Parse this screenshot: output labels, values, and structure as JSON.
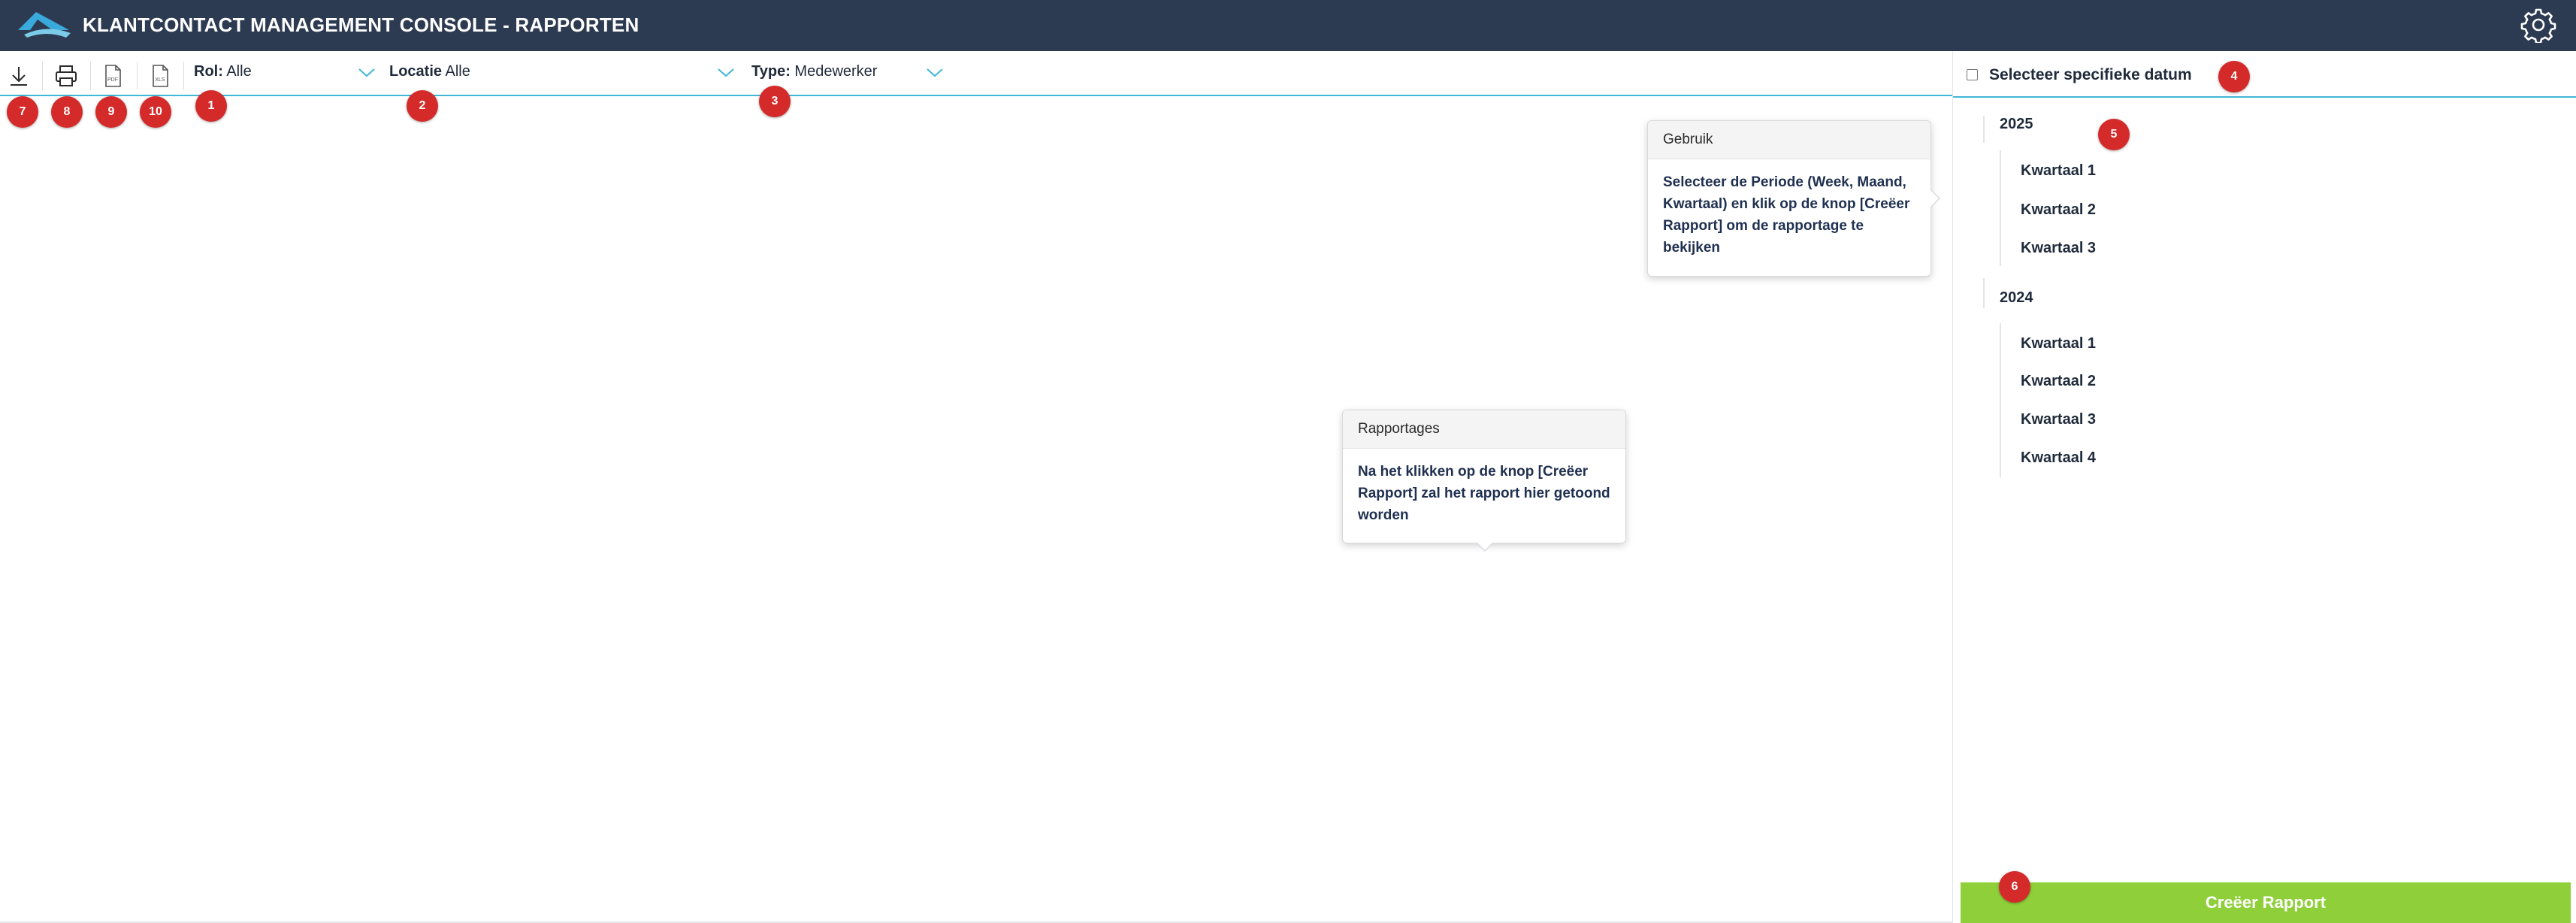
{
  "header": {
    "title": "KLANTCONTACT MANAGEMENT CONSOLE - RAPPORTEN",
    "logo_icon": "wave-logo-icon",
    "settings_icon": "gear-icon",
    "colors": {
      "background": "#2d3b52",
      "logo_primary": "#3aa9dc",
      "logo_secondary": "#7ccbe8"
    }
  },
  "toolbar": {
    "icons": [
      "download-icon",
      "print-icon",
      "pdf-icon",
      "excel-icon"
    ],
    "filters": [
      {
        "label": "Rol:",
        "value": "Alle"
      },
      {
        "label": "Locatie",
        "value": "Alle"
      },
      {
        "label": "Type:",
        "value": "Medewerker"
      }
    ],
    "accent": "#41b7d6"
  },
  "date_panel": {
    "checkbox_label": "Selecteer specifieke datum",
    "checked": false,
    "years": [
      {
        "year": "2025",
        "quarters": [
          "Kwartaal 1",
          "Kwartaal 2",
          "Kwartaal 3"
        ]
      },
      {
        "year": "2024",
        "quarters": [
          "Kwartaal 1",
          "Kwartaal 2",
          "Kwartaal 3",
          "Kwartaal 4"
        ]
      }
    ],
    "create_button": "Creëer Rapport",
    "button_color": "#8ecf3a"
  },
  "popovers": {
    "usage": {
      "title": "Gebruik",
      "body": "Selecteer de Periode (Week, Maand, Kwartaal) en klik op de knop [Creëer Rapport] om de rapportage te bekijken"
    },
    "reports": {
      "title": "Rapportages",
      "body": "Na het klikken op de knop [Creëer Rapport] zal het rapport hier getoond worden"
    }
  },
  "markers": [
    "1",
    "2",
    "3",
    "4",
    "5",
    "6",
    "7",
    "8",
    "9",
    "10"
  ],
  "marker_color": "#d42a2a"
}
